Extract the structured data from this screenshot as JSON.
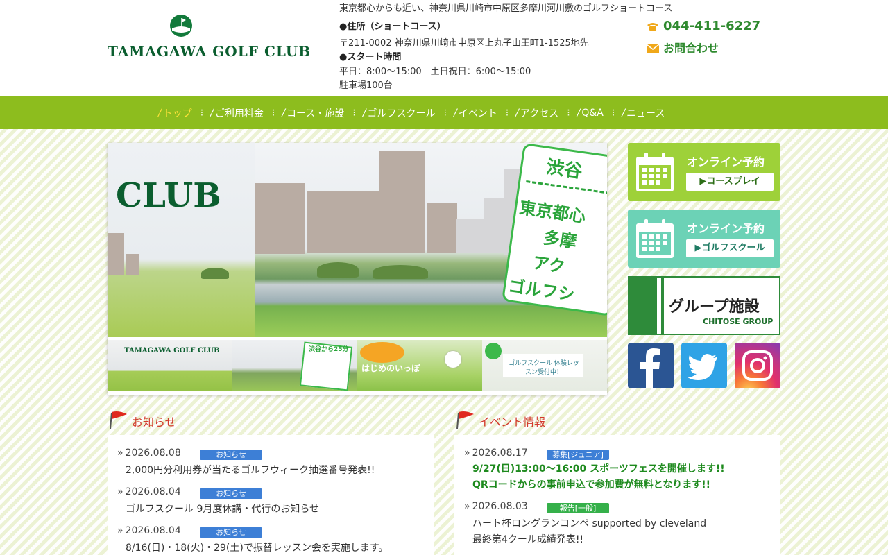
{
  "header": {
    "logo_text": "TAMAGAWA GOLF CLUB",
    "tagline": "東京都心からも近い、神奈川県川崎市中原区多摩川河川敷のゴルフショートコース",
    "address_label": "●住所（ショートコース）",
    "address": "〒211-0002 神奈川県川崎市中原区上丸子山王町1-1525地先",
    "hours_label": "●スタート時間",
    "hours": "平日：8:00～15:00　土日祝日：6:00～15:00",
    "parking": "駐車場100台",
    "phone": "044-411-6227",
    "contact": "お問合わせ"
  },
  "nav": {
    "items": [
      {
        "label": "トップ",
        "active": true
      },
      {
        "label": "ご利用料金"
      },
      {
        "label": "コース・施設"
      },
      {
        "label": "ゴルフスクール"
      },
      {
        "label": "イベント"
      },
      {
        "label": "アクセス"
      },
      {
        "label": "Q&A"
      },
      {
        "label": "ニュース"
      }
    ]
  },
  "slider": {
    "club_title": "CLUB",
    "sign_lines": [
      "渋谷",
      "東京都心",
      "多摩",
      "アク",
      "ゴルフシ"
    ],
    "thumbs": [
      {
        "label": "TAMAGAWA GOLF CLUB"
      },
      {
        "label": "渋谷から25分"
      },
      {
        "label": "はじめのいっぽ"
      },
      {
        "label": "ゴルフスクール 体験レッスン受付中！"
      }
    ]
  },
  "sidebar": {
    "course_button": {
      "title": "オンライン予約",
      "sub": "▶コースプレイ"
    },
    "school_button": {
      "title": "オンライン予約",
      "sub": "▶ゴルフスクール"
    },
    "group": {
      "title": "グループ施設",
      "sub": "CHITOSE GROUP"
    },
    "social": [
      "facebook-icon",
      "twitter-icon",
      "instagram-icon"
    ]
  },
  "news": {
    "title": "お知らせ",
    "items": [
      {
        "date": "2026.08.08",
        "badge": "お知らせ",
        "title": "2,000円分利用券が当たるゴルフウィーク抽選番号発表!!"
      },
      {
        "date": "2026.08.04",
        "badge": "お知らせ",
        "title": "ゴルフスクール 9月度休講・代行のお知らせ"
      },
      {
        "date": "2026.08.04",
        "badge": "お知らせ",
        "title": "8/16(日)・18(火)・29(土)で振替レッスン会を実施します。"
      }
    ]
  },
  "events": {
    "title": "イベント情報",
    "items": [
      {
        "date": "2026.08.17",
        "badge": "募集[ジュニア]",
        "title": "9/27(日)13:00～16:00 スポーツフェスを開催します!!",
        "title2": "QRコードからの事前申込で参加費が無料となります!!"
      },
      {
        "date": "2026.08.03",
        "badge": "報告[一般]",
        "title": "ハート杯ロングランコンペ supported by cleveland",
        "title2": "最終第4クール成績発表!!"
      }
    ]
  },
  "colors": {
    "brand_green": "#8dbd1e",
    "logo_green": "#0b5e2f",
    "accent_red": "#d23a2b"
  }
}
